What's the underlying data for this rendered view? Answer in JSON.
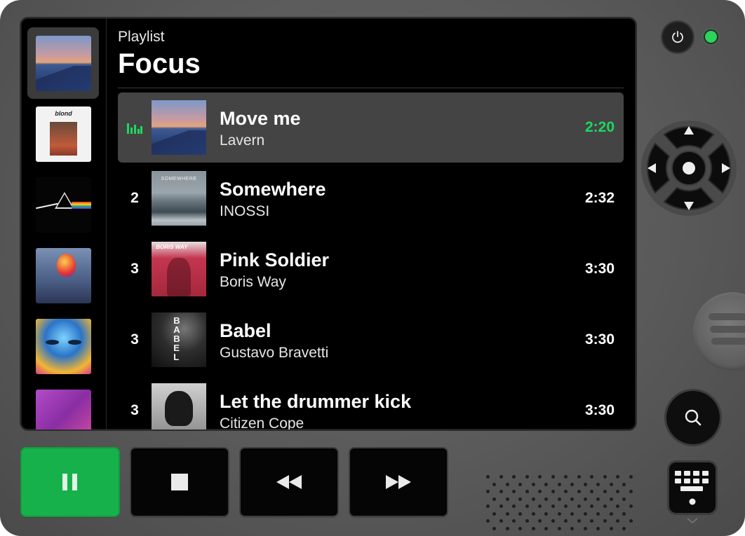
{
  "header": {
    "subtitle": "Playlist",
    "title": "Focus"
  },
  "sidebar": {
    "items": [
      {
        "name": "album-mountain",
        "art": "mountain",
        "active": true
      },
      {
        "name": "album-blond",
        "art": "blond",
        "art_text": "blond"
      },
      {
        "name": "album-prism",
        "art": "prism"
      },
      {
        "name": "album-balloon",
        "art": "balloon"
      },
      {
        "name": "album-face",
        "art": "face"
      },
      {
        "name": "album-pink",
        "art": "pink"
      }
    ]
  },
  "tracks": [
    {
      "number": "",
      "title": "Move me",
      "artist": "Lavern",
      "duration": "2:20",
      "playing": true,
      "art": "mountain"
    },
    {
      "number": "2",
      "title": "Somewhere",
      "artist": "INOSSI",
      "duration": "2:32",
      "art": "somewhere",
      "art_text": "SOMEWHERE"
    },
    {
      "number": "3",
      "title": "Pink Soldier",
      "artist": "Boris Way",
      "duration": "3:30",
      "art": "boris",
      "art_text": "BORIS WAY"
    },
    {
      "number": "3",
      "title": "Babel",
      "artist": "Gustavo Bravetti",
      "duration": "3:30",
      "art": "babel",
      "art_text": "BABEL"
    },
    {
      "number": "3",
      "title": "Let the drummer kick",
      "artist": "Citizen Cope",
      "duration": "3:30",
      "art": "drummer"
    }
  ],
  "controls": {
    "play_pause": {
      "icon": "pause-icon",
      "color": "#16b14b"
    },
    "stop": {
      "icon": "stop-icon"
    },
    "rewind": {
      "icon": "rewind-icon"
    },
    "fast_forward": {
      "icon": "fast-forward-icon"
    }
  },
  "side_panel": {
    "power": {
      "icon": "power-icon"
    },
    "status_led": {
      "color": "#2bd45a"
    },
    "dpad": {
      "icons": [
        "arrow-up-icon",
        "arrow-down-icon",
        "arrow-left-icon",
        "arrow-right-icon",
        "center-dot-icon"
      ]
    },
    "search": {
      "icon": "search-icon"
    },
    "keyboard": {
      "icon": "keyboard-icon"
    }
  },
  "colors": {
    "accent": "#1ed760",
    "active_row": "#444444",
    "screen": "#000000"
  }
}
